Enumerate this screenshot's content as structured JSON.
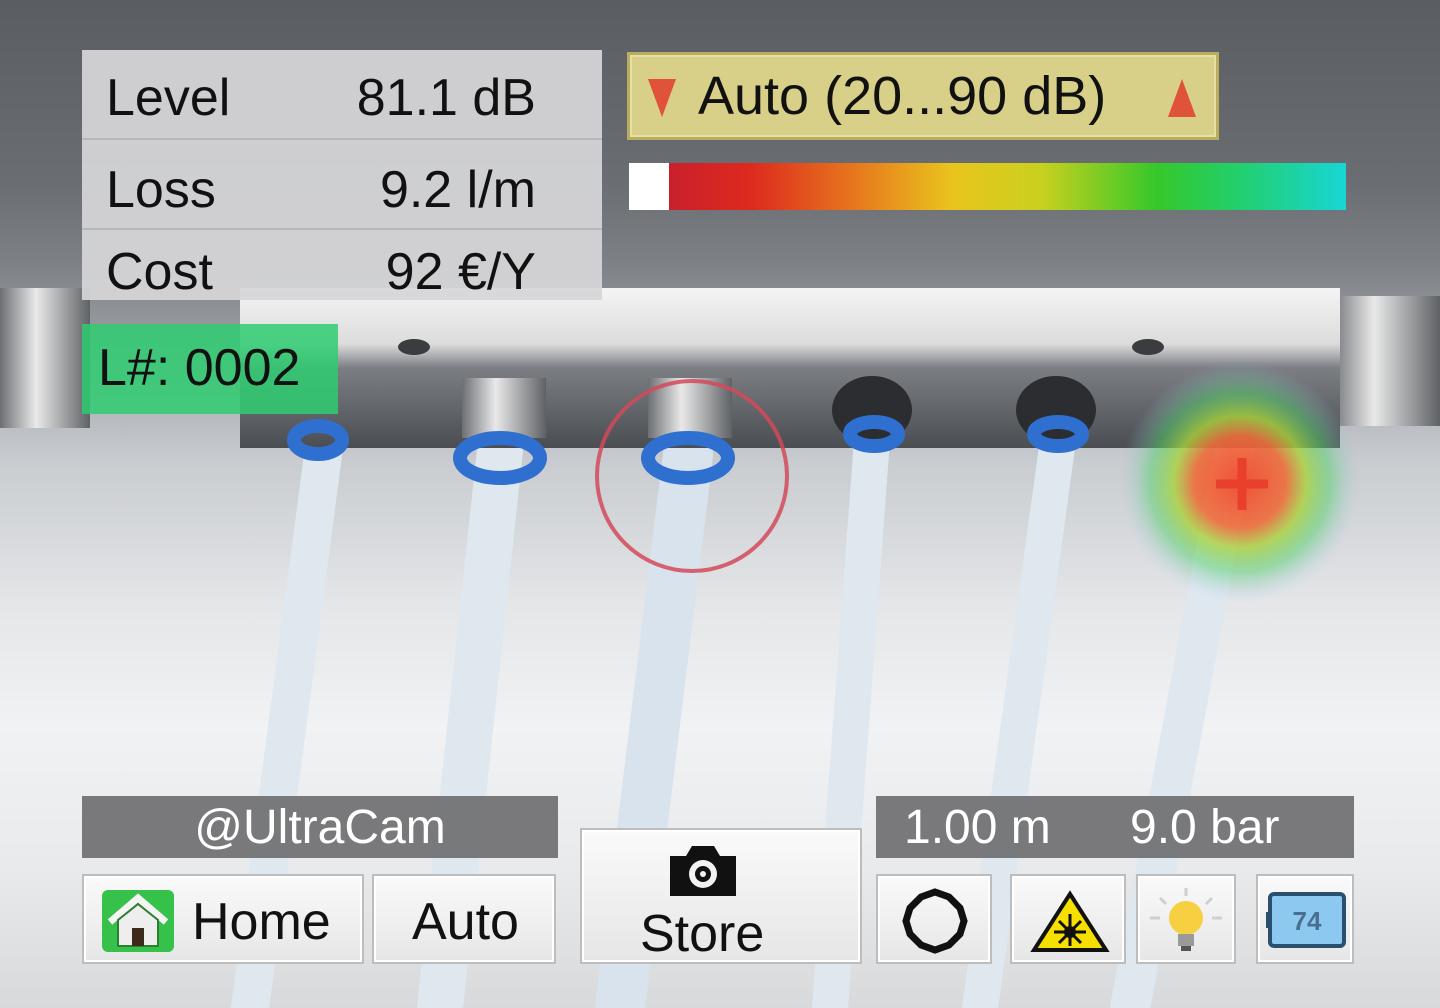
{
  "measurements": {
    "level": {
      "label": "Level",
      "value": "81.1 dB"
    },
    "loss": {
      "label": "Loss",
      "value": "9.2 l/m"
    },
    "cost": {
      "label": "Cost",
      "value": "92 €/Y"
    }
  },
  "leak_number": "L#: 0002",
  "range": {
    "label": "Auto (20...90 dB)"
  },
  "user": "@UltraCam",
  "buttons": {
    "home": "Home",
    "auto": "Auto",
    "store": "Store"
  },
  "status": {
    "distance": "1.00 m",
    "pressure": "9.0 bar"
  },
  "battery_level": "74",
  "icons": [
    "range-down-icon",
    "range-up-icon",
    "home-icon",
    "camera-icon",
    "settings-gear-icon",
    "laser-warning-icon",
    "light-bulb-icon",
    "battery-icon",
    "crosshair-icon"
  ],
  "colors": {
    "accent_green": "#2ecc71",
    "range_bg": "#d8cf88",
    "arrow_red": "#e0523a",
    "hotspot": "#f05032"
  }
}
